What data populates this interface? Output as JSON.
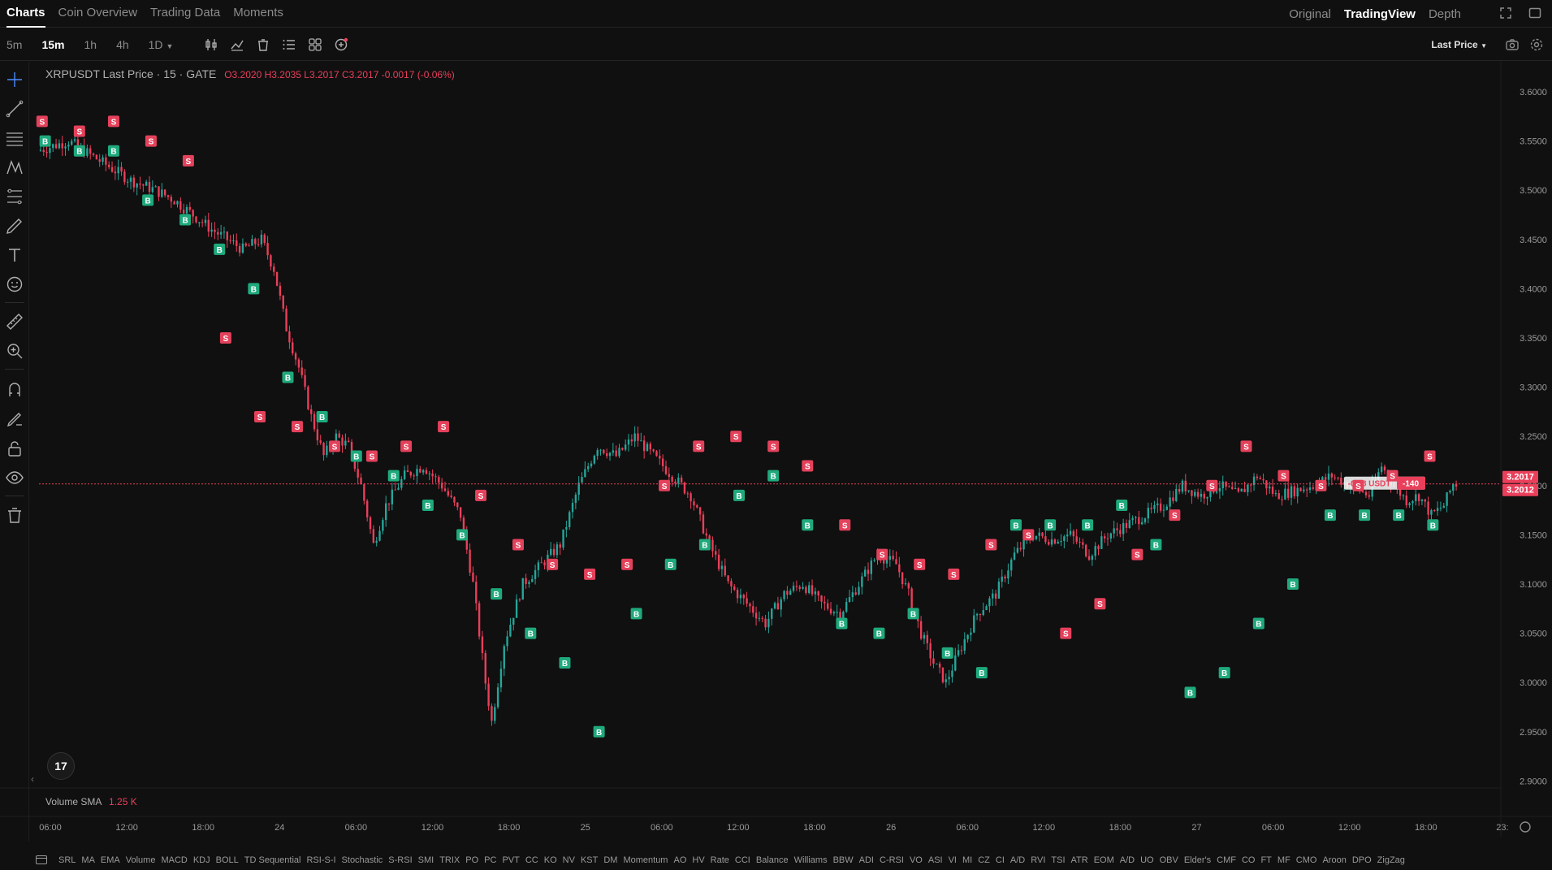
{
  "top_tabs": [
    "Charts",
    "Coin Overview",
    "Trading Data",
    "Moments"
  ],
  "top_views": [
    "Original",
    "TradingView",
    "Depth"
  ],
  "intervals": [
    "5m",
    "15m",
    "1h",
    "4h",
    "1D"
  ],
  "last_price_label": "Last Price",
  "legend": {
    "symbol": "XRPUSDT Last Price · 15 · GATE",
    "ohlc": "O3.2020  H3.2035  L3.2017  C3.2017  -0.0017 (-0.06%)"
  },
  "volume": {
    "label": "Volume SMA",
    "value": "1.25 K"
  },
  "price_axis": [
    "3.6000",
    "3.5500",
    "3.5000",
    "3.4500",
    "3.4000",
    "3.3500",
    "3.3000",
    "3.2500",
    "3.2000",
    "3.1500",
    "3.1000",
    "3.0500",
    "3.0000",
    "2.9500",
    "2.9000"
  ],
  "price_tags": {
    "last": "3.2017",
    "mark": "3.2012"
  },
  "position_label": {
    "pnl": "-0.18 USDT",
    "qty": "-140"
  },
  "time_axis": [
    "06:00",
    "12:00",
    "18:00",
    "24",
    "06:00",
    "12:00",
    "18:00",
    "25",
    "06:00",
    "12:00",
    "18:00",
    "26",
    "06:00",
    "12:00",
    "18:00",
    "27",
    "06:00",
    "12:00",
    "18:00",
    "23:"
  ],
  "indicators": [
    "SRL",
    "MA",
    "EMA",
    "Volume",
    "MACD",
    "KDJ",
    "BOLL",
    "TD Sequential",
    "RSI-S-I",
    "Stochastic",
    "S-RSI",
    "SMI",
    "TRIX",
    "PO",
    "PC",
    "PVT",
    "CC",
    "KO",
    "NV",
    "KST",
    "DM",
    "Momentum",
    "AO",
    "HV",
    "Rate",
    "CCI",
    "Balance",
    "Williams",
    "BBW",
    "ADI",
    "C-RSI",
    "VO",
    "ASI",
    "VI",
    "MI",
    "CZ",
    "CI",
    "A/D",
    "RVI",
    "TSI",
    "ATR",
    "EOM",
    "A/D",
    "UO",
    "OBV",
    "Elder's",
    "CMF",
    "CO",
    "FT",
    "MF",
    "CMO",
    "Aroon",
    "DPO",
    "ZigZag"
  ],
  "tv_logo": "17",
  "colors": {
    "up": "#26a69a",
    "down": "#ea3f5b",
    "buy": "#1fa97c",
    "sell": "#e4415b",
    "bg": "#101010"
  },
  "chart_data": {
    "type": "candlestick",
    "y_range": [
      2.88,
      3.63
    ],
    "x_axis_labels": [
      "06:00",
      "12:00",
      "18:00",
      "24",
      "06:00",
      "12:00",
      "18:00",
      "25",
      "06:00",
      "12:00",
      "18:00",
      "26",
      "06:00",
      "12:00",
      "18:00",
      "27",
      "06:00",
      "12:00",
      "18:00",
      "23:"
    ],
    "price_path": [
      [
        0,
        3.54
      ],
      [
        10,
        3.55
      ],
      [
        20,
        3.53
      ],
      [
        30,
        3.51
      ],
      [
        38,
        3.5
      ],
      [
        44,
        3.49
      ],
      [
        56,
        3.46
      ],
      [
        66,
        3.44
      ],
      [
        72,
        3.45
      ],
      [
        76,
        3.42
      ],
      [
        80,
        3.36
      ],
      [
        84,
        3.32
      ],
      [
        88,
        3.27
      ],
      [
        92,
        3.23
      ],
      [
        96,
        3.25
      ],
      [
        100,
        3.24
      ],
      [
        104,
        3.2
      ],
      [
        108,
        3.14
      ],
      [
        112,
        3.18
      ],
      [
        118,
        3.21
      ],
      [
        124,
        3.22
      ],
      [
        130,
        3.2
      ],
      [
        136,
        3.17
      ],
      [
        140,
        3.1
      ],
      [
        144,
        3.0
      ],
      [
        146,
        2.96
      ],
      [
        150,
        3.04
      ],
      [
        156,
        3.1
      ],
      [
        162,
        3.12
      ],
      [
        168,
        3.14
      ],
      [
        174,
        3.2
      ],
      [
        180,
        3.24
      ],
      [
        186,
        3.23
      ],
      [
        192,
        3.25
      ],
      [
        198,
        3.23
      ],
      [
        204,
        3.21
      ],
      [
        210,
        3.19
      ],
      [
        216,
        3.14
      ],
      [
        222,
        3.1
      ],
      [
        228,
        3.08
      ],
      [
        234,
        3.06
      ],
      [
        240,
        3.09
      ],
      [
        246,
        3.1
      ],
      [
        252,
        3.08
      ],
      [
        258,
        3.07
      ],
      [
        264,
        3.1
      ],
      [
        270,
        3.13
      ],
      [
        276,
        3.12
      ],
      [
        280,
        3.09
      ],
      [
        284,
        3.05
      ],
      [
        288,
        3.02
      ],
      [
        292,
        3.0
      ],
      [
        296,
        3.03
      ],
      [
        302,
        3.07
      ],
      [
        308,
        3.09
      ],
      [
        314,
        3.13
      ],
      [
        320,
        3.15
      ],
      [
        326,
        3.145
      ],
      [
        332,
        3.15
      ],
      [
        338,
        3.13
      ],
      [
        344,
        3.15
      ],
      [
        350,
        3.16
      ],
      [
        356,
        3.17
      ],
      [
        362,
        3.18
      ],
      [
        368,
        3.2
      ],
      [
        374,
        3.19
      ],
      [
        380,
        3.2
      ],
      [
        386,
        3.19
      ],
      [
        392,
        3.21
      ],
      [
        398,
        3.19
      ],
      [
        404,
        3.195
      ],
      [
        410,
        3.2
      ],
      [
        416,
        3.21
      ],
      [
        422,
        3.2
      ],
      [
        428,
        3.19
      ],
      [
        432,
        3.22
      ],
      [
        436,
        3.2
      ],
      [
        440,
        3.185
      ],
      [
        444,
        3.19
      ],
      [
        448,
        3.17
      ],
      [
        452,
        3.18
      ],
      [
        455,
        3.2017
      ]
    ],
    "buy_signals": [
      3.55,
      3.54,
      3.54,
      3.49,
      3.47,
      3.44,
      3.4,
      3.31,
      3.27,
      3.23,
      3.21,
      3.18,
      3.15,
      3.09,
      3.05,
      3.02,
      2.95,
      3.07,
      3.12,
      3.14,
      3.19,
      3.21,
      3.16,
      3.06,
      3.05,
      3.07,
      3.03,
      3.01,
      3.16,
      3.16,
      3.16,
      3.18,
      3.14,
      2.99,
      3.01,
      3.06,
      3.1,
      3.17,
      3.17,
      3.17,
      3.16
    ],
    "sell_signals": [
      3.57,
      3.56,
      3.57,
      3.55,
      3.53,
      3.35,
      3.27,
      3.26,
      3.24,
      3.23,
      3.24,
      3.26,
      3.19,
      3.14,
      3.12,
      3.11,
      3.12,
      3.2,
      3.24,
      3.25,
      3.24,
      3.22,
      3.16,
      3.13,
      3.12,
      3.11,
      3.14,
      3.15,
      3.05,
      3.08,
      3.13,
      3.17,
      3.2,
      3.24,
      3.21,
      3.2,
      3.2,
      3.21,
      3.23
    ]
  }
}
